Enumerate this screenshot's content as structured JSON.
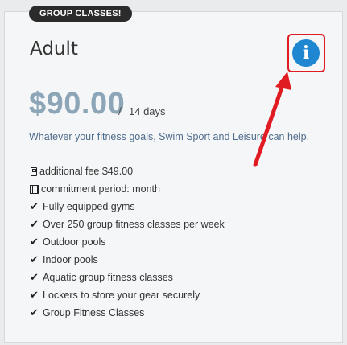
{
  "badge": "GROUP CLASSES!",
  "plan": {
    "title": "Adult",
    "price": "$90.00",
    "separator": "/",
    "period": "14 days",
    "description": "Whatever your fitness goals, Swim Sport and Leisure can help."
  },
  "info_button": {
    "glyph": "i"
  },
  "features": [
    {
      "icon": "calculator-icon",
      "text": "additional fee $49.00"
    },
    {
      "icon": "calendar-icon",
      "text": "commitment period: month"
    },
    {
      "icon": "check-icon",
      "text": "Fully equipped gyms"
    },
    {
      "icon": "check-icon",
      "text": "Over 250 group fitness classes per week"
    },
    {
      "icon": "check-icon",
      "text": "Outdoor pools"
    },
    {
      "icon": "check-icon",
      "text": "Indoor pools"
    },
    {
      "icon": "check-icon",
      "text": "Aquatic group fitness classes"
    },
    {
      "icon": "check-icon",
      "text": "Lockers to store your gear securely"
    },
    {
      "icon": "check-icon",
      "text": "Group Fitness Classes"
    }
  ],
  "colors": {
    "accent_blue": "#1f87d2",
    "highlight_red": "#e11b22",
    "price": "#8ca6b8",
    "badge_bg": "#2b2b2b"
  }
}
